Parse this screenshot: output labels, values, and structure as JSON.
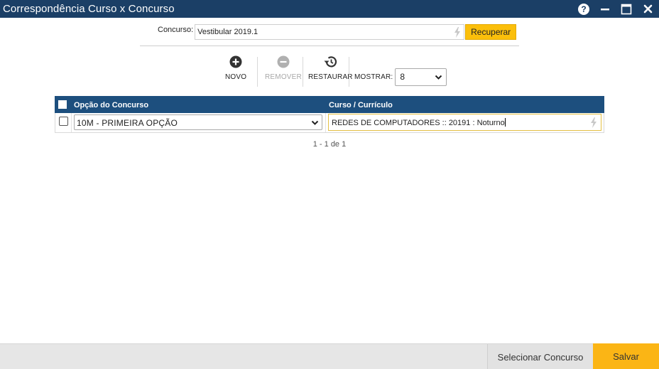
{
  "window": {
    "title": "Correspondência Curso x Concurso",
    "help_icon": "?"
  },
  "filter": {
    "concurso_label": "Concurso:",
    "concurso_value": "Vestibular 2019.1",
    "recuperar_label": "Recuperar"
  },
  "toolbar": {
    "novo_label": "NOVO",
    "remover_label": "REMOVER",
    "restaurar_label": "RESTAURAR",
    "mostrar_label": "MOSTRAR:",
    "mostrar_value": "8"
  },
  "grid": {
    "columns": [
      "Opção do Concurso",
      "Curso / Currículo"
    ],
    "rows": [
      {
        "opcao": "10M - PRIMEIRA OPÇÃO",
        "curso": "REDES DE COMPUTADORES :: 20191 : Noturno"
      }
    ],
    "pager": "1 - 1 de 1"
  },
  "footer": {
    "selecionar_label": "Selecionar Concurso",
    "salvar_label": "Salvar"
  },
  "colors": {
    "titlebar": "#1b3f66",
    "grid_header": "#1d4f7e",
    "accent": "#fbbf0b",
    "footer": "#e6e6e6"
  }
}
